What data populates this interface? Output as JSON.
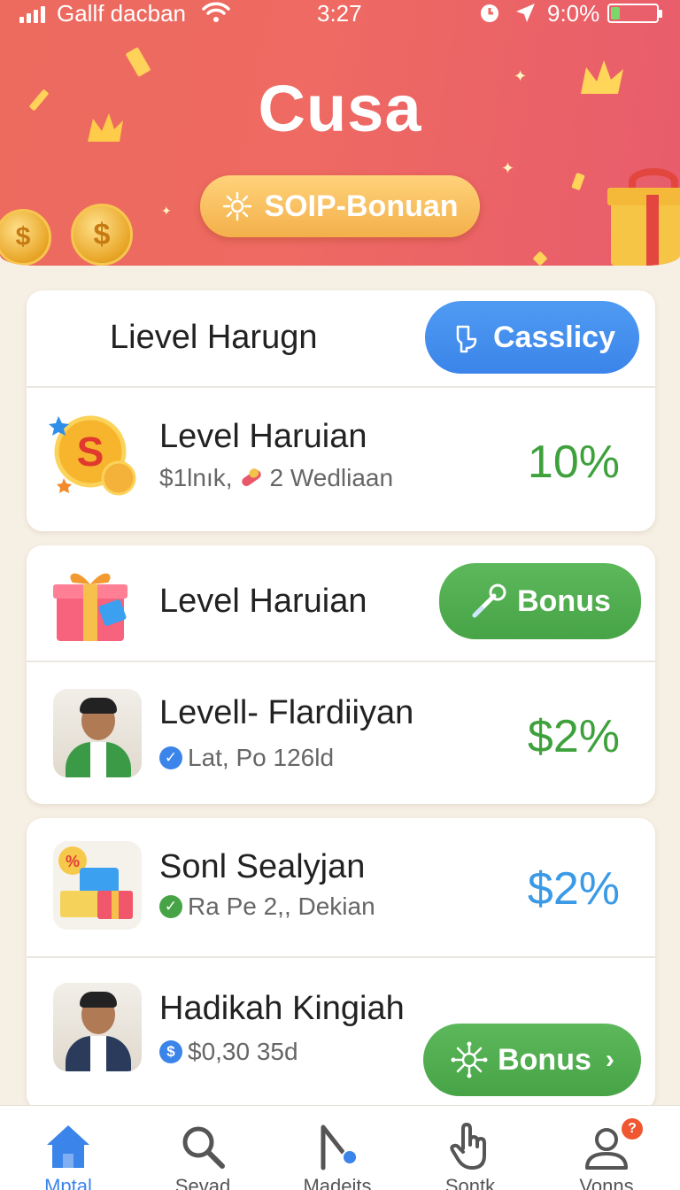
{
  "status_bar": {
    "carrier": "Gallf dacban",
    "time": "3:27",
    "battery_text": "9:0%",
    "battery_level": 0.2
  },
  "header": {
    "title": "Cusa",
    "bonus_label": "SOIP-Bonuan"
  },
  "section": {
    "title": "Lievel Harugn",
    "action_label": "Casslicy"
  },
  "rows": [
    {
      "title": "Level Haruian",
      "subtitle_a": "$1lnık,",
      "subtitle_b": "2 Wedliaan",
      "value": "10%",
      "icon": "coin-icon"
    },
    {
      "title": "Level Haruian",
      "action_label": "Bonus",
      "icon": "gift-icon"
    },
    {
      "title": "Levell- Flardiiyan",
      "subtitle": "Lat, Po 126ld",
      "value": "$2%",
      "icon": "avatar"
    },
    {
      "title": "Sonl Sealyjan",
      "subtitle": "Ra Pe 2,, Dekian",
      "value": "$2%",
      "icon": "basket-icon"
    },
    {
      "title": "Hadikah Kingiah",
      "subtitle": "$0,30 35d",
      "action_label": "Bonus",
      "icon": "avatar"
    }
  ],
  "nav": [
    {
      "label": "Mptal",
      "icon": "home-icon",
      "active": true
    },
    {
      "label": "Sevad",
      "icon": "search-icon"
    },
    {
      "label": "Madeits",
      "icon": "marker-icon"
    },
    {
      "label": "Sontk",
      "icon": "hand-icon"
    },
    {
      "label": "Vonns",
      "icon": "profile-icon",
      "badge": "?"
    }
  ],
  "colors": {
    "header_start": "#ec6a5e",
    "header_end": "#e85c6c",
    "accent_blue": "#3b84ea",
    "accent_green": "#47a446",
    "bonus_gold": "#f3b04a"
  }
}
